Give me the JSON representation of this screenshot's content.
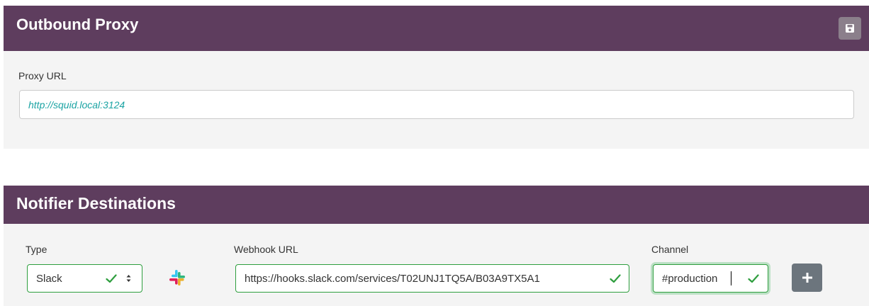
{
  "outbound_proxy": {
    "title": "Outbound Proxy",
    "save_icon": "floppy-disk-icon",
    "proxy_url_label": "Proxy URL",
    "proxy_url_value": "http://squid.local:3124"
  },
  "notifier": {
    "title": "Notifier Destinations",
    "type_label": "Type",
    "type_value": "Slack",
    "type_icon": "slack-icon",
    "webhook_label": "Webhook URL",
    "webhook_value": "https://hooks.slack.com/services/T02UNJ1TQ5A/B03A9TX5A1",
    "channel_label": "Channel",
    "channel_value": "#production",
    "add_icon": "plus-icon"
  },
  "colors": {
    "header_bg": "#5e3d5e",
    "valid_green": "#2e9e3e",
    "proxy_text": "#1aa3a3",
    "add_button": "#6c757d"
  }
}
